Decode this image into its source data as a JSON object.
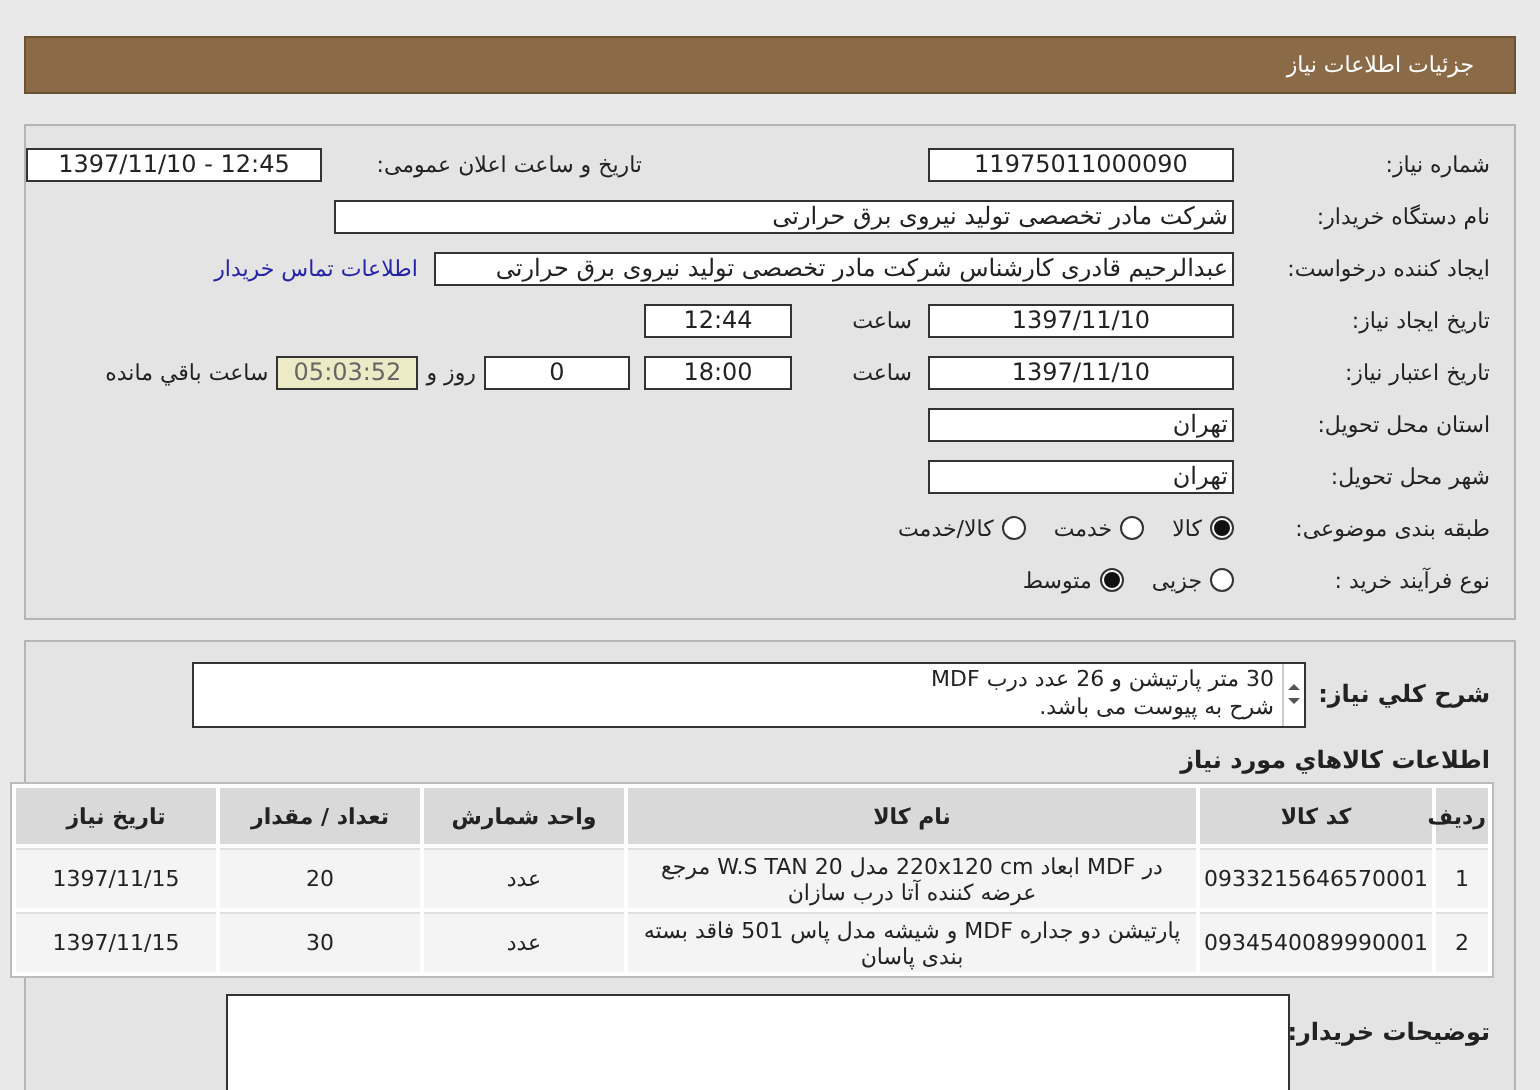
{
  "header": {
    "title": "جزئیات اطلاعات نیاز"
  },
  "form": {
    "need_number": {
      "label": "شماره نیاز:",
      "value": "11975011000090"
    },
    "announce": {
      "label": "تاریخ و ساعت اعلان عمومی:",
      "value": "1397/11/10 - 12:45"
    },
    "buyer": {
      "label": "نام دستگاه خریدار:",
      "value": "شرکت مادر تخصصی تولید نیروی برق حرارتی"
    },
    "requester": {
      "label": "ایجاد کننده درخواست:",
      "value": "عبدالرحیم قادری کارشناس شرکت مادر تخصصی تولید نیروی برق حرارتی",
      "link": "اطلاعات تماس خریدار"
    },
    "created": {
      "label": "تاریخ ایجاد نیاز:",
      "date": "1397/11/10",
      "time_label": "ساعت",
      "time": "12:44"
    },
    "validity": {
      "label": "تاریخ اعتبار نیاز:",
      "date": "1397/11/10",
      "time_label": "ساعت",
      "time": "18:00",
      "days": "0",
      "days_label": "روز و",
      "remaining": "05:03:52",
      "remaining_label": "ساعت باقي مانده"
    },
    "province": {
      "label": "استان محل تحویل:",
      "value": "تهران"
    },
    "city": {
      "label": "شهر محل تحویل:",
      "value": "تهران"
    },
    "category": {
      "label": "طبقه بندی موضوعی:",
      "options": [
        {
          "label": "کالا",
          "selected": true
        },
        {
          "label": "خدمت",
          "selected": false
        },
        {
          "label": "کالا/خدمت",
          "selected": false
        }
      ]
    },
    "process": {
      "label": "نوع فرآیند خرید :",
      "options": [
        {
          "label": "جزیی",
          "selected": false
        },
        {
          "label": "متوسط",
          "selected": true
        }
      ]
    }
  },
  "description": {
    "label": "شرح کلي نياز:",
    "lines": [
      "30 متر پارتیشن و 26 عدد درب MDF",
      "شرح به پیوست می باشد."
    ]
  },
  "goods": {
    "title": "اطلاعات کالاهاي مورد نياز",
    "columns": [
      "ردیف",
      "کد کالا",
      "نام کالا",
      "واحد شمارش",
      "تعداد / مقدار",
      "تاریخ نیاز"
    ],
    "rows": [
      [
        "1",
        "0933215646570001",
        "در MDF ابعاد 220x120 cm مدل W.S TAN 20 مرجع عرضه کننده آتا درب سازان",
        "عدد",
        "20",
        "1397/11/15"
      ],
      [
        "2",
        "0934540089990001",
        "پارتیشن دو جداره MDF و شیشه مدل پاس 501 فاقد بسته بندی پاسان",
        "عدد",
        "30",
        "1397/11/15"
      ]
    ]
  },
  "notes": {
    "label": "توضیحات خریدار:"
  }
}
